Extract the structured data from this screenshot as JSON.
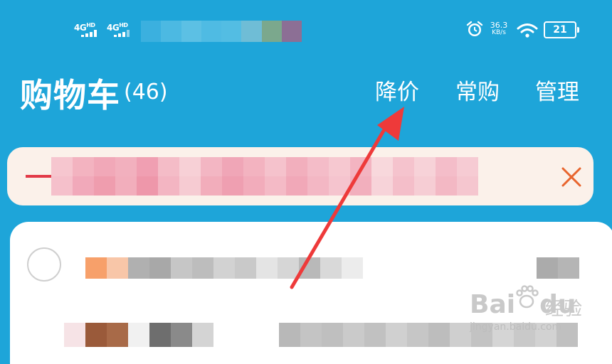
{
  "status_bar": {
    "sim1_label": "4G",
    "sim1_sup": "HD",
    "sim2_label": "4G",
    "sim2_sup": "HD",
    "net_speed_value": "36.3",
    "net_speed_unit": "KB/s",
    "battery_level": "21",
    "icons": [
      "signal-icon",
      "signal-icon",
      "alarm-icon",
      "wifi-icon",
      "battery-icon"
    ]
  },
  "header": {
    "title": "购物车",
    "count": "(46)",
    "tabs": [
      {
        "label": "降价"
      },
      {
        "label": "常购"
      },
      {
        "label": "管理"
      }
    ]
  },
  "banner": {
    "close_icon": "close-icon",
    "colors": {
      "background": "#fbf1ea",
      "close": "#e8652e"
    }
  },
  "watermark": {
    "logo": "Bai",
    "logo_tail": "du",
    "brand": "经验",
    "url": "jingyan.baidu.com"
  },
  "colors": {
    "accent": "#1ea5d9",
    "arrow": "#ee3a3a"
  }
}
